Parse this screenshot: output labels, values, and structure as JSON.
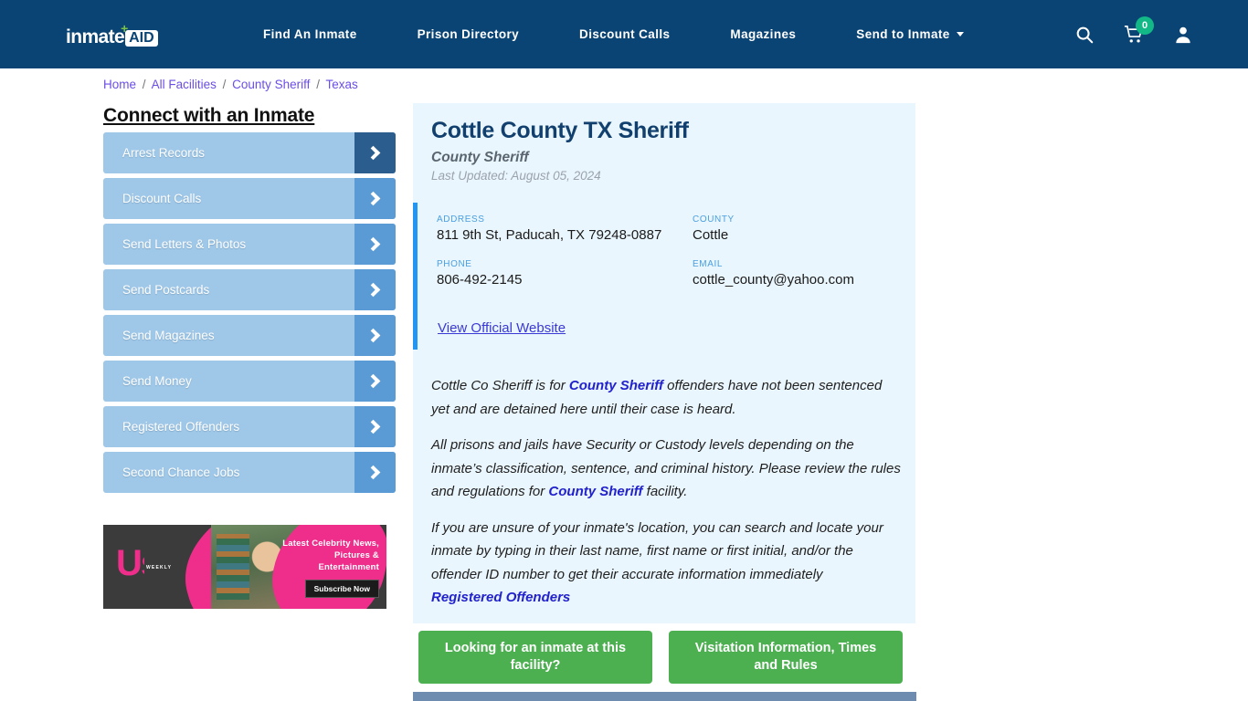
{
  "header": {
    "logo": {
      "word": "inmate",
      "badge": "AID",
      "cross": "+"
    },
    "nav": [
      {
        "label": "Find An Inmate",
        "has_caret": false
      },
      {
        "label": "Prison Directory",
        "has_caret": false
      },
      {
        "label": "Discount Calls",
        "has_caret": false
      },
      {
        "label": "Magazines",
        "has_caret": false
      },
      {
        "label": "Send to Inmate",
        "has_caret": true
      }
    ],
    "icons": {
      "search": "search-icon",
      "cart": "cart-icon",
      "account": "user-icon"
    },
    "cart_count": "0",
    "navy": "#0a4474",
    "badge_green": "#12b886"
  },
  "breadcrumb": {
    "items": [
      "Home",
      "All Facilities",
      "County Sheriff",
      "Texas"
    ],
    "separator": "/"
  },
  "sidebar": {
    "title": "Connect with an Inmate",
    "items": [
      {
        "label": "Arrest Records"
      },
      {
        "label": "Discount Calls"
      },
      {
        "label": "Send Letters & Photos"
      },
      {
        "label": "Send Postcards"
      },
      {
        "label": "Send Magazines"
      },
      {
        "label": "Send Money"
      },
      {
        "label": "Registered Offenders"
      },
      {
        "label": "Second Chance Jobs"
      }
    ],
    "item_bg": "#9ec7e8",
    "chevron_bg": "#5b9bd5",
    "chevron_bg_active": "#2c5d8f"
  },
  "ad": {
    "brand": "Us",
    "brand_sub": "WEEKLY",
    "text": "Latest Celebrity News, Pictures & Entertainment",
    "button": "Subscribe Now",
    "pink": "#ef2e8b"
  },
  "facility": {
    "name": "Cottle County TX Sheriff",
    "type": "County Sheriff",
    "last_updated": "Last Updated: August 05, 2024",
    "fields": [
      {
        "label": "ADDRESS",
        "value": "811 9th St, Paducah, TX 79248-0887"
      },
      {
        "label": "COUNTY",
        "value": "Cottle"
      },
      {
        "label": "PHONE",
        "value": "806-492-2145"
      },
      {
        "label": "EMAIL",
        "value": "cottle_county@yahoo.com"
      }
    ],
    "website_link": "View Official Website",
    "accent_color": "#2196f3",
    "card_bg": "#eaf6fd"
  },
  "description": {
    "p1_a": "Cottle Co Sheriff is for ",
    "p1_link": "County Sheriff",
    "p1_b": " offenders have not been sentenced yet and are detained here until their case is heard.",
    "p2_a": "All prisons and jails have Security or Custody levels depending on the inmate’s classification, sentence, and criminal history. Please review the rules and regulations for ",
    "p2_link": "County Sheriff",
    "p2_b": " facility.",
    "p3_a": "If you are unsure of your inmate's location, you can search and locate your inmate by typing in their last name, first name or first initial, and/or the offender ID number to get their accurate information immediately",
    "p3_link": "Registered Offenders"
  },
  "cta": {
    "left": "Looking for an inmate at this facility?",
    "right": "Visitation Information, Times and Rules",
    "green": "#4caf50"
  }
}
